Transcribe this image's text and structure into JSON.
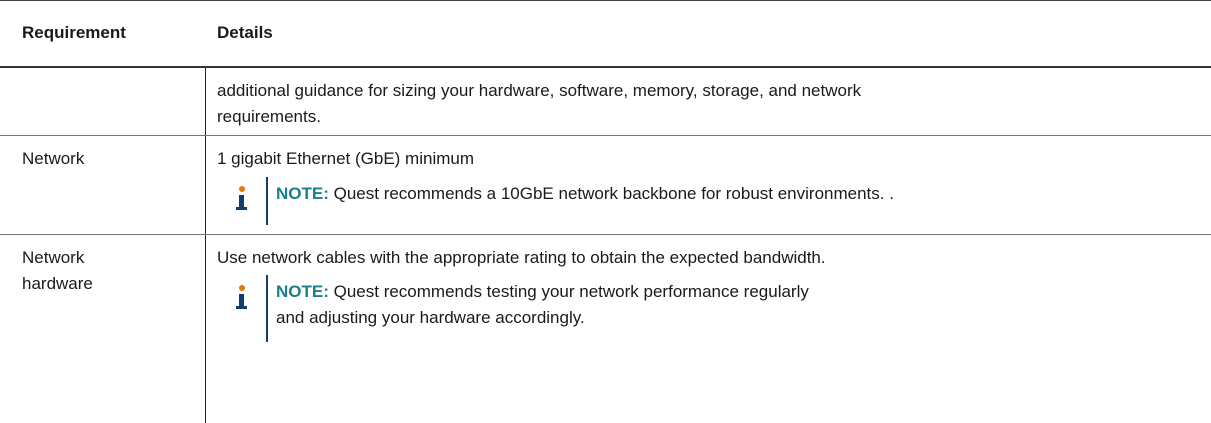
{
  "table": {
    "headers": {
      "requirement": "Requirement",
      "details": "Details"
    },
    "rows": [
      {
        "requirement": "",
        "details": "additional guidance for sizing your hardware, software, memory, storage, and network requirements."
      },
      {
        "requirement": "Network",
        "details": "1 gigabit Ethernet (GbE) minimum",
        "note_label": "NOTE:",
        "note_text": " Quest recommends a 10GbE network backbone for robust environments. ."
      },
      {
        "requirement": "Network hardware",
        "details": "Use network cables with the appropriate rating to obtain the expected bandwidth.",
        "note_label": "NOTE:",
        "note_text": " Quest recommends testing your network performance regularly and adjusting your hardware accordingly."
      }
    ]
  },
  "colors": {
    "note_label": "#17808a",
    "icon_dot": "#e07a10",
    "icon_stem": "#123d6e"
  },
  "icons": [
    "info-icon"
  ]
}
